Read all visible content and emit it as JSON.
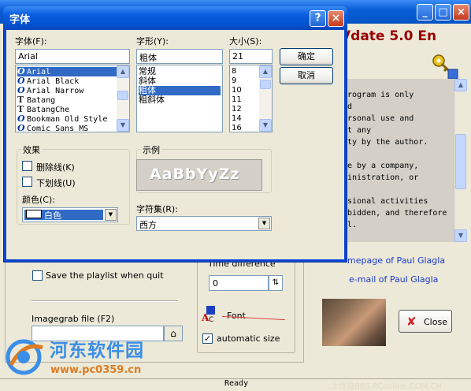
{
  "background_app": {
    "title": "Vdate 5.0 En",
    "info_lines": [
      "rogram is only",
      "d",
      "rsonal use and",
      "t any",
      "ty by the author.",
      "",
      "e by a company,",
      "inistration, or",
      "",
      "sional activities",
      "bidden, and therefore",
      "l."
    ],
    "links": {
      "homepage": "mepage of Paul Glagla",
      "email": "e-mail of Paul Glagla"
    },
    "time_difference_label": "Time difference",
    "time_difference_value": "0",
    "font_label": "Font",
    "automatic_size_label": "automatic size",
    "automatic_size_checked": true,
    "save_playlist_label": "Save the playlist when quit",
    "save_playlist_checked": false,
    "imagegrab_label": "Imagegrab file (F2)",
    "imagegrab_value": "",
    "close_label": "Close",
    "status_text": "Ready",
    "status_right": "上传自BBS.PConline.COM.CN"
  },
  "watermark": {
    "name": "河东软件园",
    "url": "www.pc0359.cn"
  },
  "font_dialog": {
    "title": "字体",
    "help_glyph": "?",
    "close_glyph": "×",
    "font_label": "字体(F):",
    "font_value": "Arial",
    "font_list": [
      {
        "name": "Arial",
        "type": "O",
        "selected": true
      },
      {
        "name": "Arial Black",
        "type": "O"
      },
      {
        "name": "Arial Narrow",
        "type": "O"
      },
      {
        "name": "Batang",
        "type": "T"
      },
      {
        "name": "BatangChe",
        "type": "T"
      },
      {
        "name": "Bookman Old Style",
        "type": "O"
      },
      {
        "name": "Comic Sans MS",
        "type": "O"
      }
    ],
    "style_label": "字形(Y):",
    "style_value": "粗体",
    "style_list": [
      {
        "name": "常规"
      },
      {
        "name": "斜体"
      },
      {
        "name": "粗体",
        "selected": true
      },
      {
        "name": "粗斜体"
      }
    ],
    "size_label": "大小(S):",
    "size_value": "21",
    "size_list": [
      "8",
      "9",
      "10",
      "11",
      "12",
      "14",
      "16"
    ],
    "ok_label": "确定",
    "cancel_label": "取消",
    "effects_label": "效果",
    "strikeout_label": "删除线(K)",
    "underline_label": "下划线(U)",
    "color_label": "颜色(C):",
    "color_value": "白色",
    "sample_label": "示例",
    "sample_text": "AaBbYyZz",
    "charset_label": "字符集(R):",
    "charset_value": "西方"
  }
}
